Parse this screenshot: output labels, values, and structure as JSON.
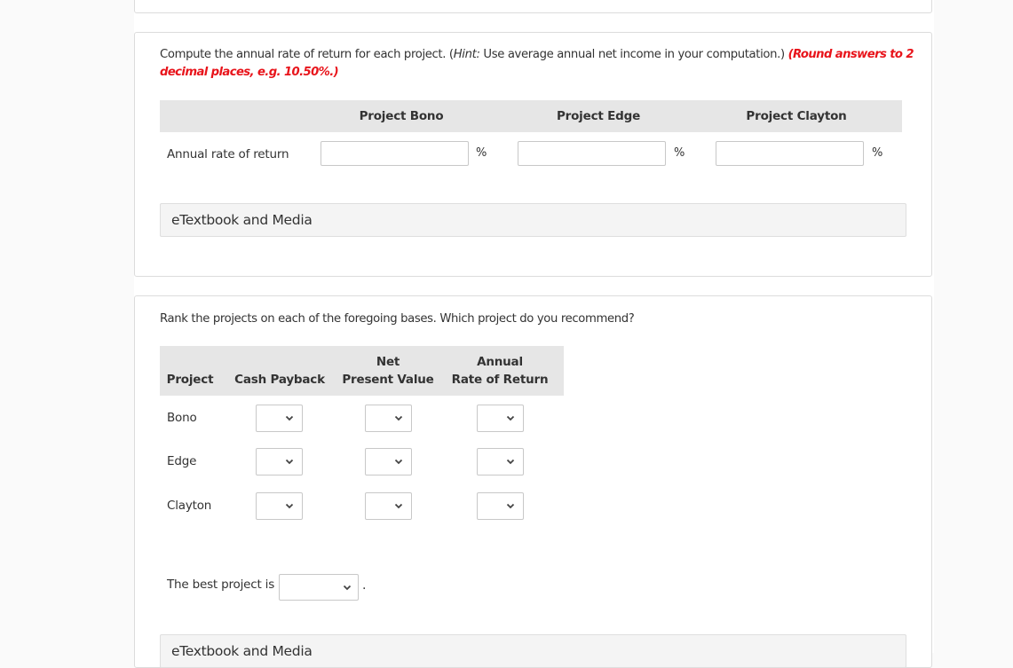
{
  "part1": {
    "prompt_text": "Compute the annual rate of return for each project. (",
    "hint_label": "Hint:",
    "hint_text": " Use average annual net income in your computation.) ",
    "round_note": "(Round answers to 2 decimal places, e.g. 10.50%.)",
    "columns": [
      "Project Bono",
      "Project Edge",
      "Project Clayton"
    ],
    "row_label": "Annual rate of return",
    "inputs": [
      {
        "project": "Bono",
        "value": "",
        "unit": "%"
      },
      {
        "project": "Edge",
        "value": "",
        "unit": "%"
      },
      {
        "project": "Clayton",
        "value": "",
        "unit": "%"
      }
    ],
    "media_label": "eTextbook and Media"
  },
  "part2": {
    "prompt_text": "Rank the projects on each of the foregoing bases. Which project do you recommend?",
    "table": {
      "headers": [
        {
          "line1": "",
          "line2": "Project"
        },
        {
          "line1": "",
          "line2": "Cash Payback"
        },
        {
          "line1": "Net",
          "line2": "Present Value"
        },
        {
          "line1": "Annual",
          "line2": "Rate of Return"
        }
      ],
      "rows": [
        {
          "project": "Bono",
          "cash_payback": "",
          "npv": "",
          "arr": ""
        },
        {
          "project": "Edge",
          "cash_payback": "",
          "npv": "",
          "arr": ""
        },
        {
          "project": "Clayton",
          "cash_payback": "",
          "npv": "",
          "arr": ""
        }
      ]
    },
    "best_project_label": "The best project is",
    "best_project_value": "",
    "best_project_suffix": ".",
    "media_label": "eTextbook and Media"
  },
  "colors": {
    "round_note": "#e8141b",
    "header_bg": "#e6e6e6",
    "media_bg": "#f4f4f4",
    "page_bg": "#fafafa"
  }
}
